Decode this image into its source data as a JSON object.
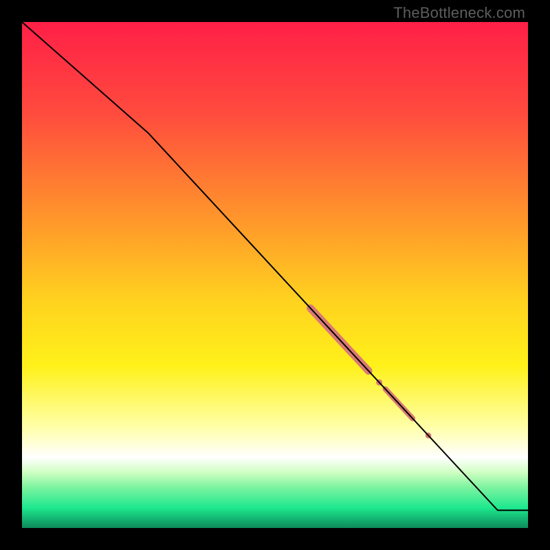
{
  "watermark": "TheBottleneck.com",
  "chart_data": {
    "type": "line",
    "title": "",
    "xlabel": "",
    "ylabel": "",
    "xlim": [
      0,
      100
    ],
    "ylim": [
      0,
      100
    ],
    "grid": false,
    "legend": false,
    "background_gradient": {
      "stops": [
        {
          "offset": 0,
          "color": "#ff1f47"
        },
        {
          "offset": 18,
          "color": "#ff4b3e"
        },
        {
          "offset": 40,
          "color": "#ff9a2a"
        },
        {
          "offset": 55,
          "color": "#ffd21f"
        },
        {
          "offset": 68,
          "color": "#fff11a"
        },
        {
          "offset": 80,
          "color": "#ffffa8"
        },
        {
          "offset": 86,
          "color": "#ffffff"
        },
        {
          "offset": 89,
          "color": "#cfffc2"
        },
        {
          "offset": 92,
          "color": "#7cf3a0"
        },
        {
          "offset": 96,
          "color": "#1de88e"
        },
        {
          "offset": 100,
          "color": "#0d8a5a"
        }
      ]
    },
    "series": [
      {
        "name": "curve",
        "stroke": "#000000",
        "stroke_width": 2,
        "points": [
          {
            "x": 0,
            "y": 100
          },
          {
            "x": 25,
            "y": 78
          },
          {
            "x": 94,
            "y": 3.5
          },
          {
            "x": 100,
            "y": 3.5
          }
        ]
      }
    ],
    "markers": {
      "color": "#d97a73",
      "segments": [
        {
          "type": "bar",
          "x1": 57,
          "x2": 68.5,
          "width": 11
        },
        {
          "type": "dot",
          "x": 70.6,
          "r": 4.5
        },
        {
          "type": "bar",
          "x1": 71.8,
          "x2": 77.2,
          "width": 8
        },
        {
          "type": "dot",
          "x": 80.3,
          "r": 4.3
        }
      ]
    }
  }
}
